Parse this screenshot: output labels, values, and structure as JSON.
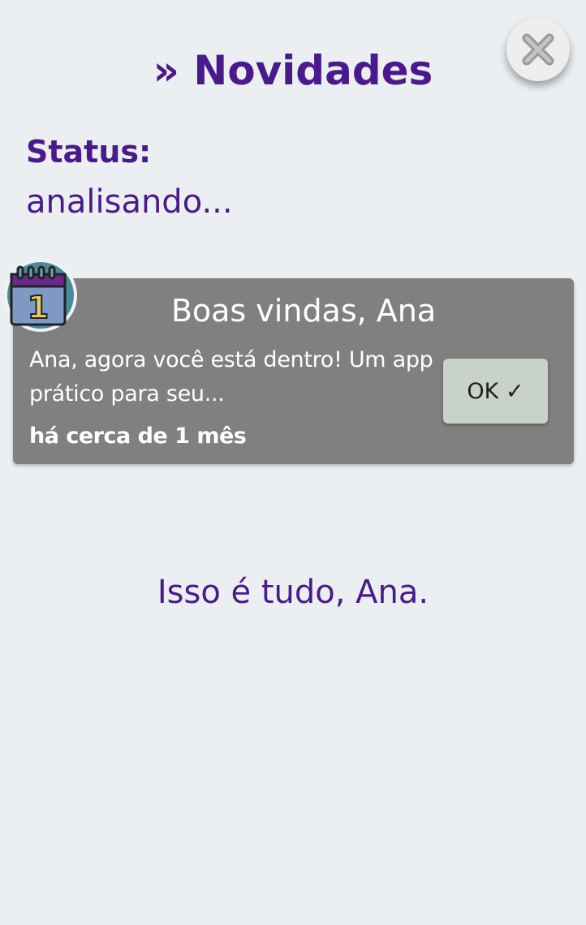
{
  "header": {
    "title": "» Novidades"
  },
  "status": {
    "label": "Status:",
    "value": "analisando..."
  },
  "notification": {
    "icon_day": "1",
    "title": "Boas vindas, Ana",
    "message": "Ana, agora você está dentro! Um app prático para seu...",
    "time": "há cerca de 1 mês",
    "ok_label": "OK ✓"
  },
  "footer": {
    "text": "Isso é tudo, Ana."
  },
  "colors": {
    "background": "#eceff2",
    "accent": "#4a1a8c",
    "card": "#808080",
    "ok_button": "#c8d2c8"
  }
}
